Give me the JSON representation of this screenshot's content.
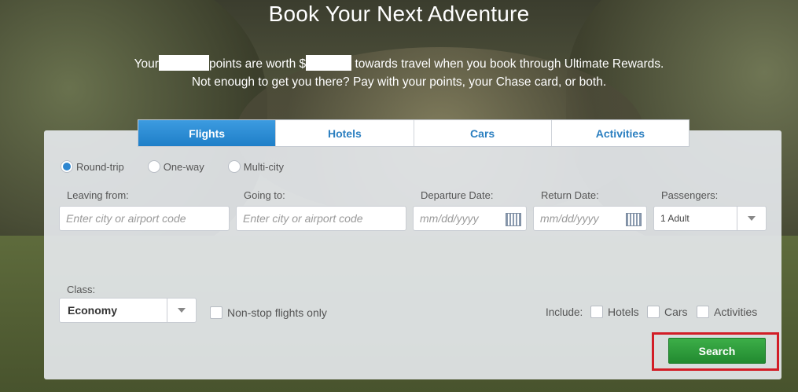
{
  "header": {
    "title": "Book Your Next Adventure",
    "line1_part1": "Your",
    "line1_part2": "points are worth $",
    "line1_part3": "towards travel when you book through Ultimate Rewards.",
    "line2": "Not enough to get you there? Pay with your points, your Chase card, or both."
  },
  "tabs": [
    {
      "label": "Flights",
      "active": true
    },
    {
      "label": "Hotels",
      "active": false
    },
    {
      "label": "Cars",
      "active": false
    },
    {
      "label": "Activities",
      "active": false
    }
  ],
  "trip_type": {
    "options": [
      "Round-trip",
      "One-way",
      "Multi-city"
    ],
    "selected": "Round-trip"
  },
  "form": {
    "leaving_label": "Leaving from:",
    "leaving_placeholder": "Enter city or airport code",
    "going_label": "Going to:",
    "going_placeholder": "Enter city or airport code",
    "departure_label": "Departure Date:",
    "departure_placeholder": "mm/dd/yyyy",
    "return_label": "Return Date:",
    "return_placeholder": "mm/dd/yyyy",
    "passengers_label": "Passengers:",
    "passengers_value": "1 Adult",
    "class_label": "Class:",
    "class_value": "Economy",
    "nonstop_label": "Non-stop flights only",
    "include_label": "Include:",
    "include_options": [
      "Hotels",
      "Cars",
      "Activities"
    ],
    "search_label": "Search"
  },
  "colors": {
    "accent_blue": "#1f7fc8",
    "search_green": "#228a30",
    "highlight_red": "#d21d26"
  }
}
